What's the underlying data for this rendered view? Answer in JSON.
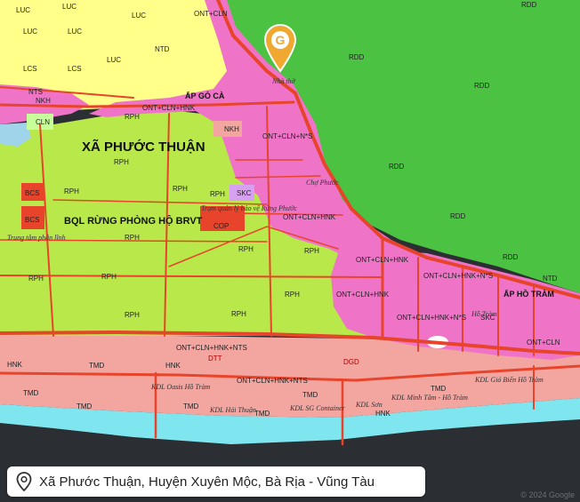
{
  "address": "Xã Phước Thuận, Huyện Xuyên Mộc, Bà Rịa - Vũng Tàu",
  "credit": "© 2024 Google",
  "marker": {
    "icon": "location-pin-marker-icon",
    "letter": "G",
    "color": "#f0a830"
  },
  "colors": {
    "forest": "#4cc243",
    "protection": "#b8e84a",
    "residential": "#ef74c8",
    "tourism": "#f3a5a0",
    "farmland": "#ffff8a",
    "roads": "#e8442b",
    "beach": "#7fe6f0",
    "sea": "#2b2f33"
  },
  "labels": {
    "commune": "XÃ PHƯỚC THUẬN",
    "board": "BQL RỪNG PHÒNG HỘ BRVT",
    "hamlet_goca": "ẤP GÒ CÀ",
    "hamlet_hotram": "ẤP HỒ TRÀM",
    "rdd1": "RDD",
    "rdd2": "RDD",
    "rdd3": "RDD",
    "rdd4": "RDD",
    "rdd5": "RDD",
    "rdd6": "RDD",
    "rph1": "RPH",
    "rph2": "RPH",
    "rph3": "RPH",
    "rph4": "RPH",
    "rph5": "RPH",
    "rph6": "RPH",
    "rph7": "RPH",
    "rph8": "RPH",
    "rph9": "RPH",
    "rph10": "RPH",
    "rph11": "RPH",
    "rph12": "RPH",
    "rph13": "RPH",
    "luc1": "LUC",
    "luc2": "LUC",
    "luc3": "LUC",
    "luc4": "LUC",
    "luc5": "LUC",
    "luc6": "LUC",
    "lcs1": "LCS",
    "lcs2": "LCS",
    "bcs1": "BCS",
    "bcs2": "BCS",
    "nts1": "NTS",
    "ntd1": "NTD",
    "ntd2": "NTD",
    "nkh1": "NKH",
    "nkh2": "NKH",
    "cln1": "CLN",
    "skc1": "SKC",
    "skc2": "SKC",
    "cop1": "COP",
    "ont1": "ONT+CLN",
    "ont2": "ONT+CLN+HNK",
    "ont3": "ONT+CLN+N*S",
    "ont4": "ONT+CLN+HNK",
    "ont5": "ONT+CLN+HNK",
    "ont6": "ONT+CLN+HNK+N*S",
    "ont7": "ONT+CLN+HNK",
    "ont8": "ONT+CLN+HNK+N*S",
    "ont9": "ONT+CLN+HNK+NTS",
    "ont10": "ONT+CLN+HNK+NTS",
    "ont11": "ONT+CLN",
    "tmd1": "TMD",
    "tmd2": "TMD",
    "tmd3": "TMD",
    "tmd4": "TMD",
    "tmd5": "TMD",
    "tmd6": "TMD",
    "tmd7": "TMD",
    "hnk1": "HNK",
    "hnk2": "HNK",
    "hnk3": "HNK",
    "dtt1": "DTT",
    "dgd1": "DGD",
    "kdl1": "KDL Oasis Hồ Tràm",
    "kdl2": "KDL Hải Thuận",
    "kdl3": "KDL SG Container",
    "kdl4": "KDL Minh Tâm - Hồ Tràm",
    "kdl5": "KDL Gió Biển Hồ Tràm",
    "kdl6": "KDL Sơn",
    "place1": "Trung tâm phân lĩnh",
    "place2": "Trạm quản lý bảo vệ Rừng Phước",
    "place3": "Nhà thờ",
    "place4": "Chợ Phước",
    "place5": "Hồ Tràm"
  }
}
